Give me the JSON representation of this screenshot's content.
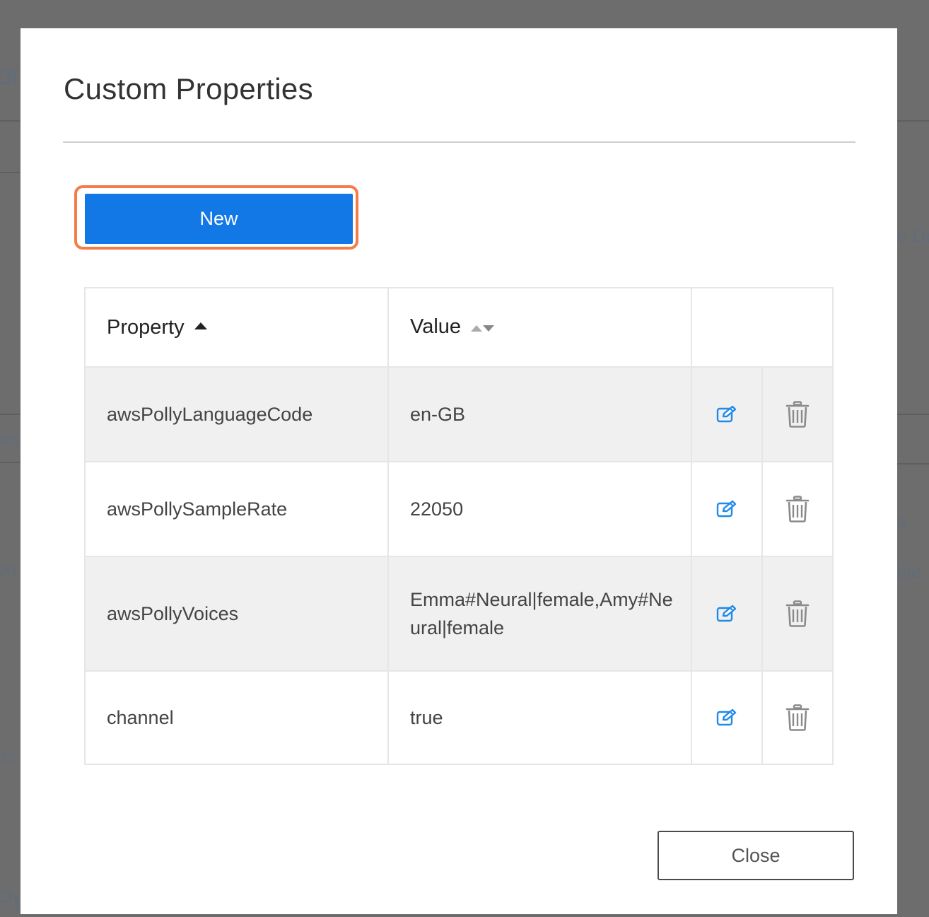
{
  "dialog": {
    "title": "Custom Properties",
    "new_label": "New",
    "close_label": "Close"
  },
  "table": {
    "columns": [
      {
        "label": "Property",
        "sort": "ascending"
      },
      {
        "label": "Value",
        "sort": "none"
      }
    ],
    "rows": [
      {
        "property": "awsPollyLanguageCode",
        "value": "en-GB"
      },
      {
        "property": "awsPollySampleRate",
        "value": "22050"
      },
      {
        "property": "awsPollyVoices",
        "value": "Emma#Neural|female,Amy#Neural|female"
      },
      {
        "property": "channel",
        "value": "true"
      }
    ],
    "row_icons": {
      "edit": "edit-icon",
      "delete": "trash-icon"
    }
  },
  "colors": {
    "primary": "#1278e6",
    "focus_ring": "#f47c48",
    "icon_blue": "#1f8ae8",
    "icon_gray": "#8a8a8a"
  }
}
